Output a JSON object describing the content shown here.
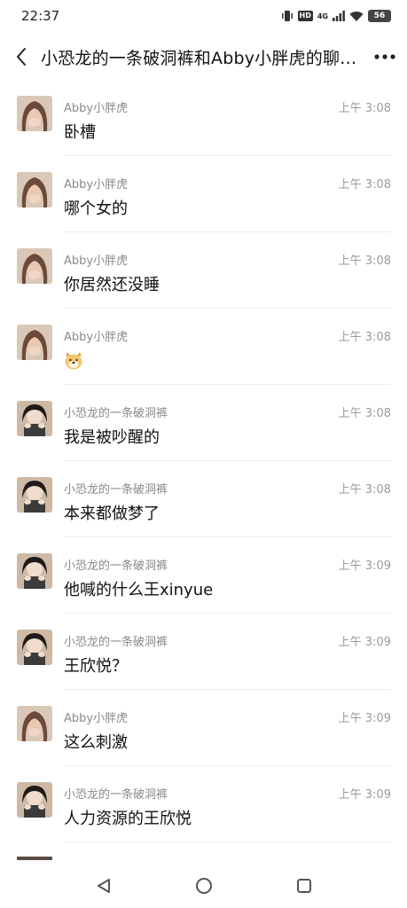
{
  "status_bar": {
    "time": "22:37",
    "hd_label": "HD",
    "network_label": "4G",
    "battery": "56"
  },
  "nav": {
    "title": "小恐龙的一条破洞裤和Abby小胖虎的聊…",
    "back_icon": "chevron-left-icon",
    "more_icon": "more-dots-icon"
  },
  "messages": [
    {
      "sender": "Abby小胖虎",
      "time": "上午 3:08",
      "text": "卧槽",
      "avatar": "abby"
    },
    {
      "sender": "Abby小胖虎",
      "time": "上午 3:08",
      "text": "哪个女的",
      "avatar": "abby"
    },
    {
      "sender": "Abby小胖虎",
      "time": "上午 3:08",
      "text": "你居然还没睡",
      "avatar": "abby"
    },
    {
      "sender": "Abby小胖虎",
      "time": "上午 3:08",
      "text": "",
      "emoji": "dog-face",
      "avatar": "abby"
    },
    {
      "sender": "小恐龙的一条破洞裤",
      "time": "上午 3:08",
      "text": "我是被吵醒的",
      "avatar": "dino"
    },
    {
      "sender": "小恐龙的一条破洞裤",
      "time": "上午 3:08",
      "text": "本来都做梦了",
      "avatar": "dino"
    },
    {
      "sender": "小恐龙的一条破洞裤",
      "time": "上午 3:09",
      "text": "他喊的什么王xinyue",
      "avatar": "dino"
    },
    {
      "sender": "小恐龙的一条破洞裤",
      "time": "上午 3:09",
      "text": "王欣悦？",
      "avatar": "dino"
    },
    {
      "sender": "Abby小胖虎",
      "time": "上午 3:09",
      "text": "这么刺激",
      "avatar": "abby"
    },
    {
      "sender": "小恐龙的一条破洞裤",
      "time": "上午 3:09",
      "text": "人力资源的王欣悦",
      "avatar": "dino"
    }
  ],
  "bottom_nav": {
    "back_icon": "triangle-back-icon",
    "home_icon": "circle-home-icon",
    "recents_icon": "square-recents-icon"
  }
}
